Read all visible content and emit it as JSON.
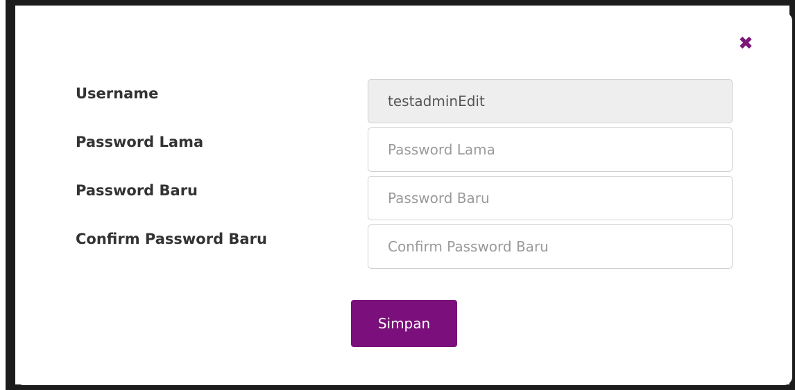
{
  "modal": {
    "close_symbol": "✖",
    "accent_color": "#7b0f7b"
  },
  "form": {
    "fields": [
      {
        "label": "Username",
        "value": "testadminEdit",
        "placeholder": "",
        "readonly": true
      },
      {
        "label": "Password Lama",
        "value": "",
        "placeholder": "Password Lama",
        "readonly": false
      },
      {
        "label": "Password Baru",
        "value": "",
        "placeholder": "Password Baru",
        "readonly": false
      },
      {
        "label": "Confirm Password Baru",
        "value": "",
        "placeholder": "Confirm Password Baru",
        "readonly": false
      }
    ],
    "submit_label": "Simpan"
  },
  "icons": {
    "close": "close-icon"
  }
}
